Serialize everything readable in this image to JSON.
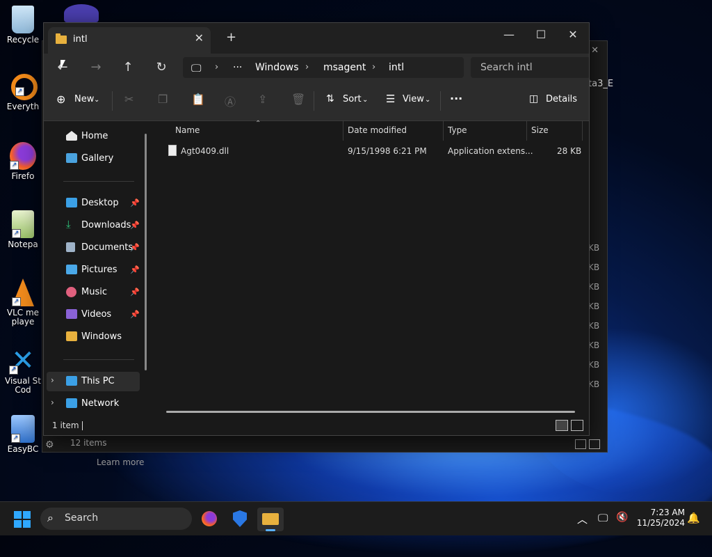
{
  "desktop": {
    "icons": [
      {
        "label": "Recycle",
        "icon": "recycle-bin-icon"
      },
      {
        "label": "Everyth",
        "icon": "everything-search-icon"
      },
      {
        "label": "Firefo",
        "icon": "firefox-icon"
      },
      {
        "label": "Notepa",
        "icon": "notepad-icon"
      },
      {
        "label": "VLC me",
        "label2": "playe",
        "icon": "vlc-icon"
      },
      {
        "label": "Visual St",
        "label2": "Cod",
        "icon": "vscode-icon"
      },
      {
        "label": "EasyBC",
        "icon": "easybcd-icon"
      }
    ]
  },
  "background_window": {
    "tab_fragment": "ta3_E",
    "size_fragments": [
      "KB",
      "KB",
      "KB",
      "KB",
      "KB",
      "KB",
      "KB",
      "KB"
    ],
    "status": "12 items",
    "learn_more": "Learn more"
  },
  "window": {
    "tab_title": "intl",
    "breadcrumb": [
      "Windows",
      "msagent",
      "intl"
    ],
    "breadcrumb_overflow": "···",
    "search_placeholder": "Search intl",
    "toolbar": {
      "new_label": "New",
      "sort_label": "Sort",
      "view_label": "View",
      "more_label": "···",
      "details_label": "Details"
    },
    "sidebar": {
      "top": [
        {
          "label": "Home",
          "icon": "home-icon",
          "color": "#e9e9e9"
        },
        {
          "label": "Gallery",
          "icon": "gallery-icon",
          "color": "#4aa3df"
        }
      ],
      "pinned": [
        {
          "label": "Desktop",
          "icon": "desktop-icon",
          "color": "#3ba0e6"
        },
        {
          "label": "Downloads",
          "icon": "download-icon",
          "color": "#2fc27a"
        },
        {
          "label": "Documents",
          "icon": "documents-icon",
          "color": "#9fb3c8"
        },
        {
          "label": "Pictures",
          "icon": "pictures-icon",
          "color": "#4aa8e8"
        },
        {
          "label": "Music",
          "icon": "music-icon",
          "color": "#e0607e"
        },
        {
          "label": "Videos",
          "icon": "videos-icon",
          "color": "#8a62d6"
        },
        {
          "label": "Windows",
          "icon": "folder-icon",
          "color": "#e8b13e"
        }
      ],
      "bottom": [
        {
          "label": "This PC",
          "icon": "this-pc-icon",
          "color": "#3ba0e6"
        },
        {
          "label": "Network",
          "icon": "network-icon",
          "color": "#3ba0e6"
        }
      ]
    },
    "columns": [
      "Name",
      "Date modified",
      "Type",
      "Size"
    ],
    "files": [
      {
        "name": "Agt0409.dll",
        "date": "9/15/1998 6:21 PM",
        "type": "Application extens...",
        "size": "28 KB"
      }
    ],
    "status": "1 item"
  },
  "taskbar": {
    "search_label": "Search",
    "time": "7:23 AM",
    "date": "11/25/2024"
  }
}
